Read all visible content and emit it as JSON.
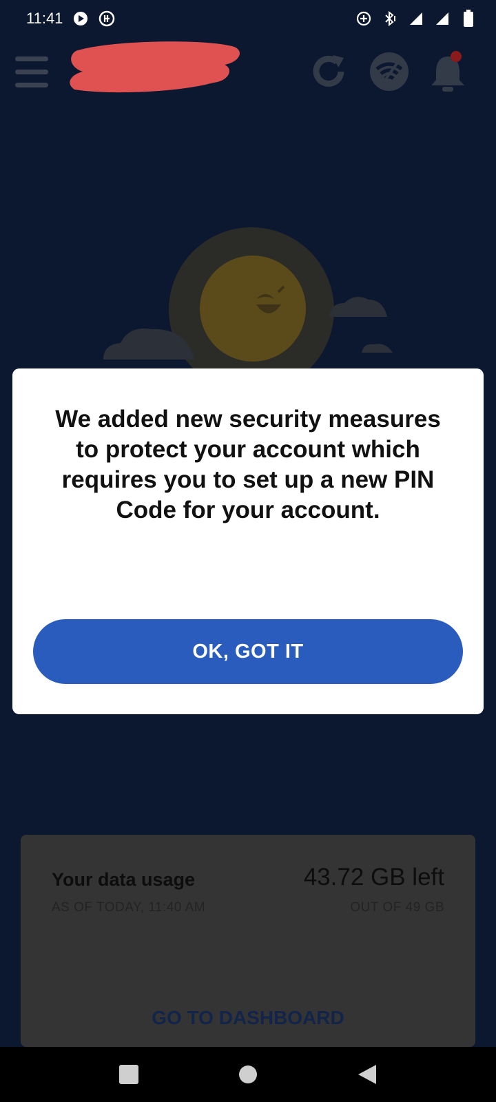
{
  "status_bar": {
    "time": "11:41",
    "icons_left": [
      "play-icon",
      "app-notification-icon"
    ],
    "icons_right": [
      "data-saver-icon",
      "bluetooth-icon",
      "signal-icon",
      "signal-icon",
      "battery-icon"
    ]
  },
  "header": {
    "menu_icon": "hamburger-icon",
    "refresh_icon": "refresh-icon",
    "wifi_icon": "wifi-icon",
    "notifications_icon": "bell-icon",
    "notification_dot_color": "#8b1a1a"
  },
  "dialog": {
    "message": "We added new security measures to protect your account which requires you to set up a new PIN Code for your account.",
    "ok_label": "OK, GOT IT",
    "button_color": "#2a5cbd"
  },
  "usage": {
    "title": "Your data usage",
    "as_of": "AS OF TODAY, 11:40 AM",
    "left": "43.72 GB left",
    "total": "OUT OF 49 GB",
    "dashboard_label": "GO TO DASHBOARD"
  },
  "nav": {
    "recents_icon": "square-icon",
    "home_icon": "circle-icon",
    "back_icon": "back-triangle-icon"
  }
}
